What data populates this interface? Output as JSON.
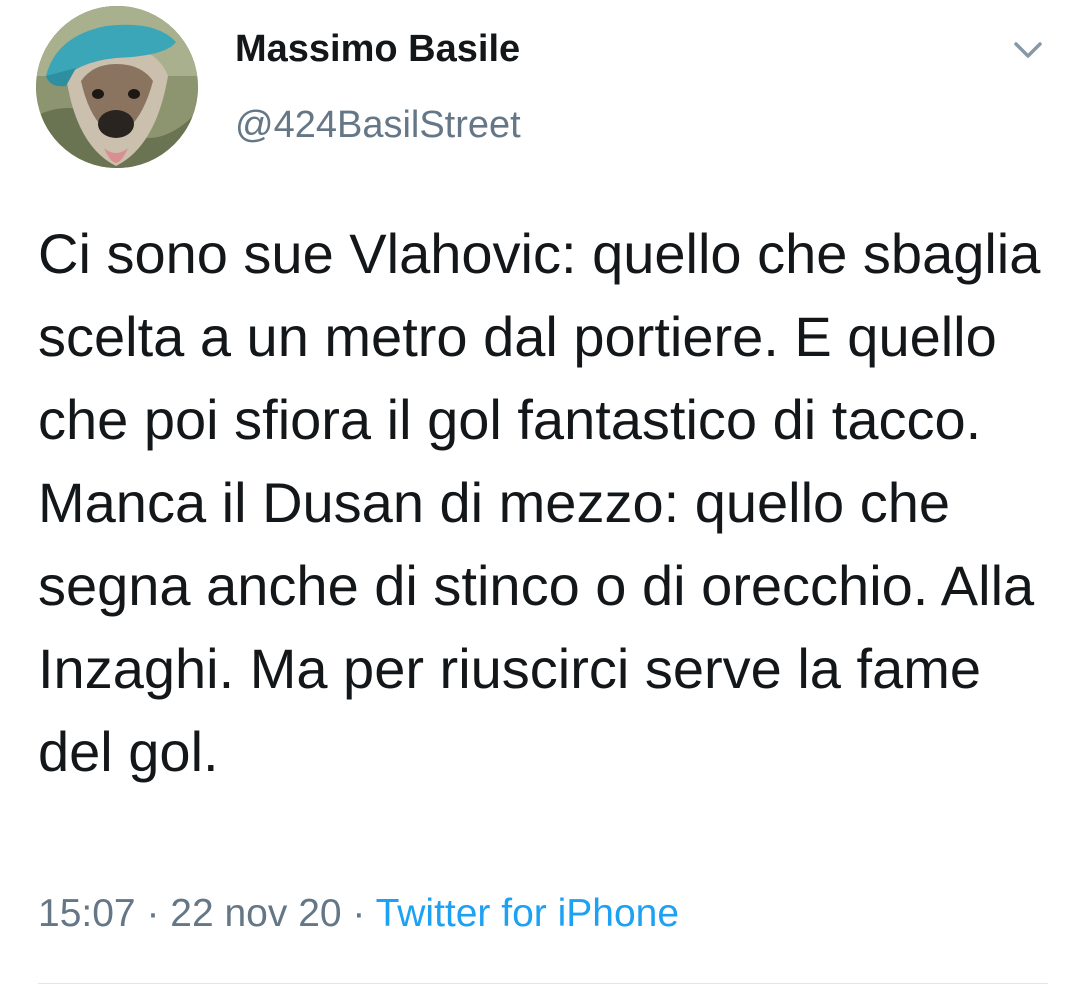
{
  "author": {
    "display_name": "Massimo Basile",
    "handle": "@424BasilStreet",
    "avatar_icon": "dog-with-cap-avatar"
  },
  "menu_icon": "chevron-down-icon",
  "tweet": {
    "text": "Ci sono sue Vlahovic: quello che sbaglia scelta a un metro dal portiere. E quello che poi sfiora il gol fantastico di tacco. Manca il Dusan di mezzo: quello che segna anche di stinco o di orecchio. Alla Inzaghi. Ma per riuscirci serve la fame del gol.",
    "time": "15:07",
    "separator": " · ",
    "date": "22 nov 20",
    "source": "Twitter for iPhone"
  },
  "colors": {
    "text": "#14171a",
    "secondary": "#657786",
    "link": "#1da1f2",
    "divider": "#e1e8ed"
  }
}
